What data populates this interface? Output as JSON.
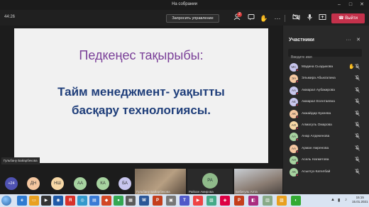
{
  "window": {
    "title": "На собрании"
  },
  "toolbar": {
    "timer": "44:26",
    "request_control": "Запросить управление",
    "participants_badge": "2",
    "leave_label": "Выйти"
  },
  "slide": {
    "title": "Педкеңес тақырыбы:",
    "body_line1": "Тайм менеджмент- уақытты",
    "body_line2": "басқару технологиясы."
  },
  "speaker_label": "Гульбану Байарбекова",
  "avatars": {
    "overflow": "+24",
    "items": [
      {
        "initials": "ДН",
        "color": "#f5c7a0"
      },
      {
        "initials": "НШ",
        "color": "#f7d8a6"
      },
      {
        "initials": "АА",
        "color": "#a7d3a0"
      },
      {
        "initials": "КА",
        "color": "#a7d3a0"
      },
      {
        "initials": "БА",
        "color": "#c8c6ee"
      }
    ]
  },
  "video_tiles": [
    {
      "name": "Гульбану Байарбекова"
    },
    {
      "name": "Райхан Амирова",
      "initials": "РА"
    },
    {
      "name": "Бибигуль Алта"
    }
  ],
  "panel": {
    "title": "Участники",
    "search_placeholder": "Введите имя",
    "participants": [
      {
        "initials": "МС",
        "name": "Мадина Сыздыкова",
        "color": "#c8c6ee",
        "hand": true
      },
      {
        "initials": "ЭА",
        "name": "Эльмира Абыкгалина",
        "color": "#f5c7a0",
        "hand": false
      },
      {
        "initials": "АА",
        "name": "Акмарал Аубакирова",
        "color": "#c8c6ee",
        "hand": false
      },
      {
        "initials": "АЕ",
        "name": "Акмарал Есентаевна",
        "color": "#c8c6ee",
        "hand": false
      },
      {
        "initials": "АК",
        "name": "Акжайдар Кукеева",
        "color": "#f5c7a0",
        "hand": false
      },
      {
        "initials": "АО",
        "name": "Алмагуль Омарова",
        "color": "#f7d8a6",
        "hand": false
      },
      {
        "initials": "АА",
        "name": "Анар Алдекенова",
        "color": "#a7d3a0",
        "hand": false
      },
      {
        "initials": "АА",
        "name": "Арман Амренова",
        "color": "#f5c7a0",
        "hand": false
      },
      {
        "initials": "АН",
        "name": "Асель Нагметова",
        "color": "#a7d3a0",
        "hand": false
      },
      {
        "initials": "АК",
        "name": "Асылгуз Кателбай",
        "color": "#a7d3a0",
        "hand": false
      }
    ]
  },
  "taskbar": {
    "time": "15:15",
    "date": "15.01.2021"
  }
}
